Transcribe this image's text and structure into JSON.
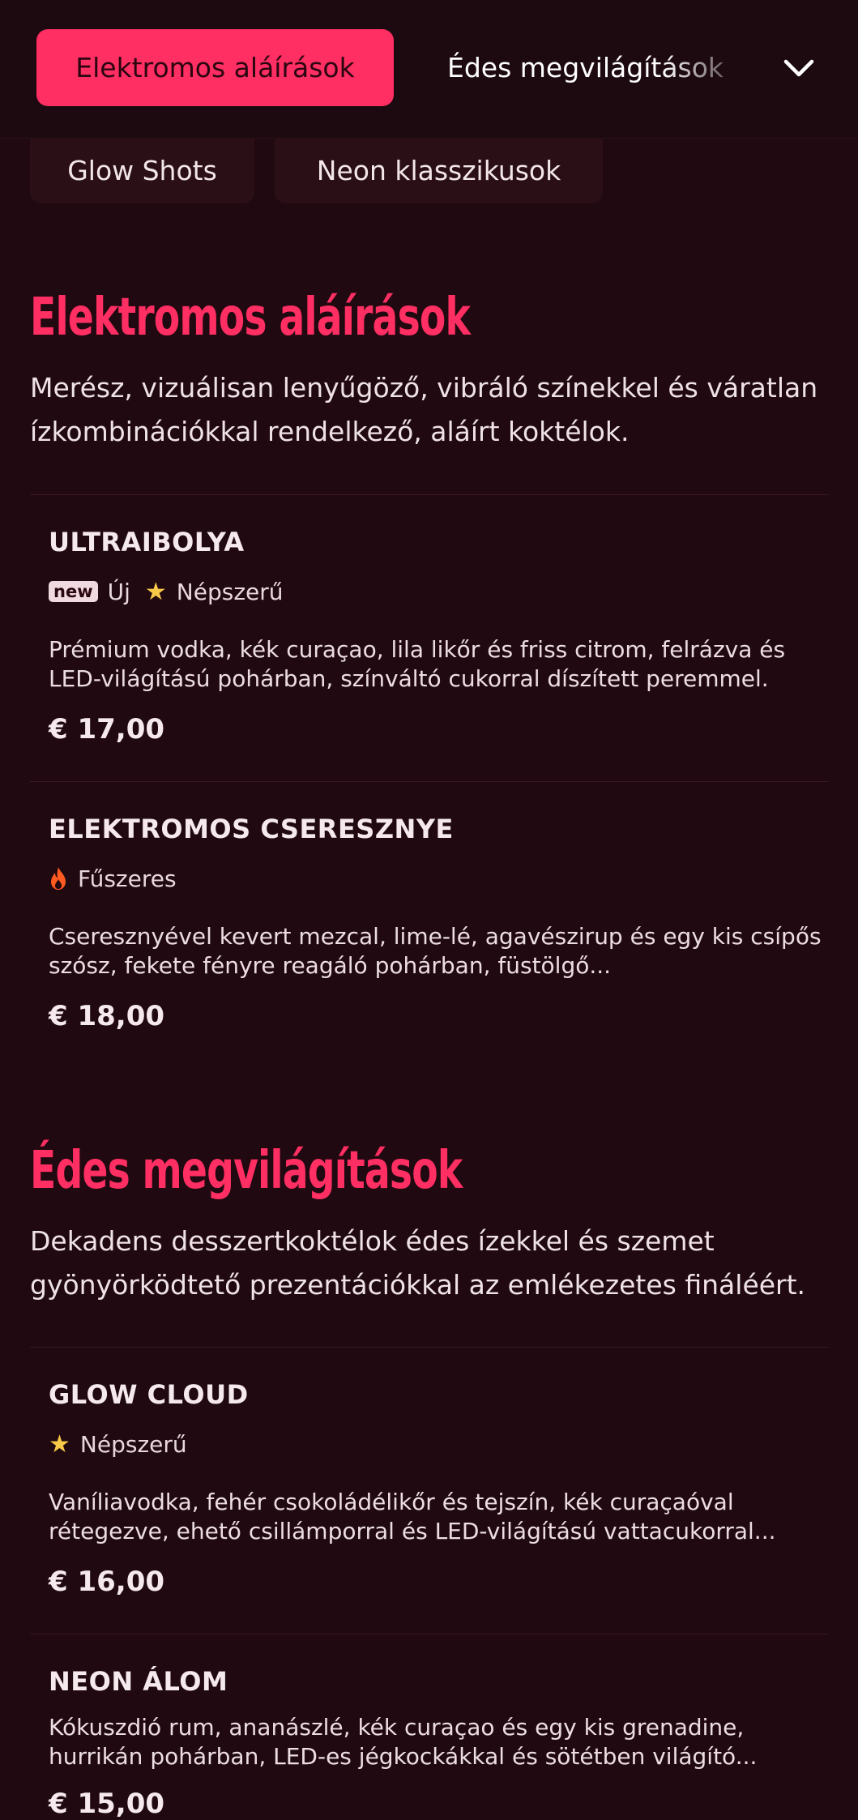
{
  "nav": {
    "tabs": [
      "Elektromos aláírások",
      "Édes megvilágítások"
    ],
    "active_tab": "Elektromos aláírások",
    "sub_tabs": [
      "Glow Shots",
      "Neon klasszikusok"
    ]
  },
  "colors": {
    "accent": "#ff2e63",
    "background": "#200910",
    "star": "#f7c948",
    "flame": "#ff5a1f"
  },
  "sections": [
    {
      "title": "Elektromos aláírások",
      "description": "Merész, vizuálisan lenyűgöző, vibráló színekkel és váratlan ízkombinációkkal rendelkező, aláírt koktélok.",
      "items": [
        {
          "name": "ULTRAIBOLYA",
          "badge": "new",
          "tags": [
            "Új",
            "Népszerű"
          ],
          "description": "Prémium vodka, kék curaçao, lila likőr és friss citrom, felrázva és LED-világítású pohárban, színváltó cukorral díszített peremmel.",
          "price": "€ 17,00"
        },
        {
          "name": "ELEKTROMOS CSERESZNYE",
          "tags": [
            "Fűszeres"
          ],
          "description": "Cseresznyével kevert mezcal, lime-lé, agavészirup és egy kis csípős szósz, fekete fényre reagáló pohárban, füstölgő...",
          "price": "€ 18,00"
        }
      ]
    },
    {
      "title": "Édes megvilágítások",
      "description": "Dekadens desszertkoktélok édes ízekkel és szemet gyönyörködtető prezentációkkal az emlékezetes fináléért.",
      "items": [
        {
          "name": "GLOW CLOUD",
          "tags": [
            "Népszerű"
          ],
          "description": "Vaníliavodka, fehér csokoládélikőr és tejszín, kék curaçaóval rétegezve, ehető csillámporral és LED-világítású vattacukorral...",
          "price": "€ 16,00"
        },
        {
          "name": "NEON ÁLOM",
          "description": "Kókuszdió rum, ananászlé, kék curaçao és egy kis grenadine, hurrikán pohárban, LED-es jégkockákkal és sötétben világító...",
          "price": "€ 15,00"
        }
      ]
    }
  ]
}
